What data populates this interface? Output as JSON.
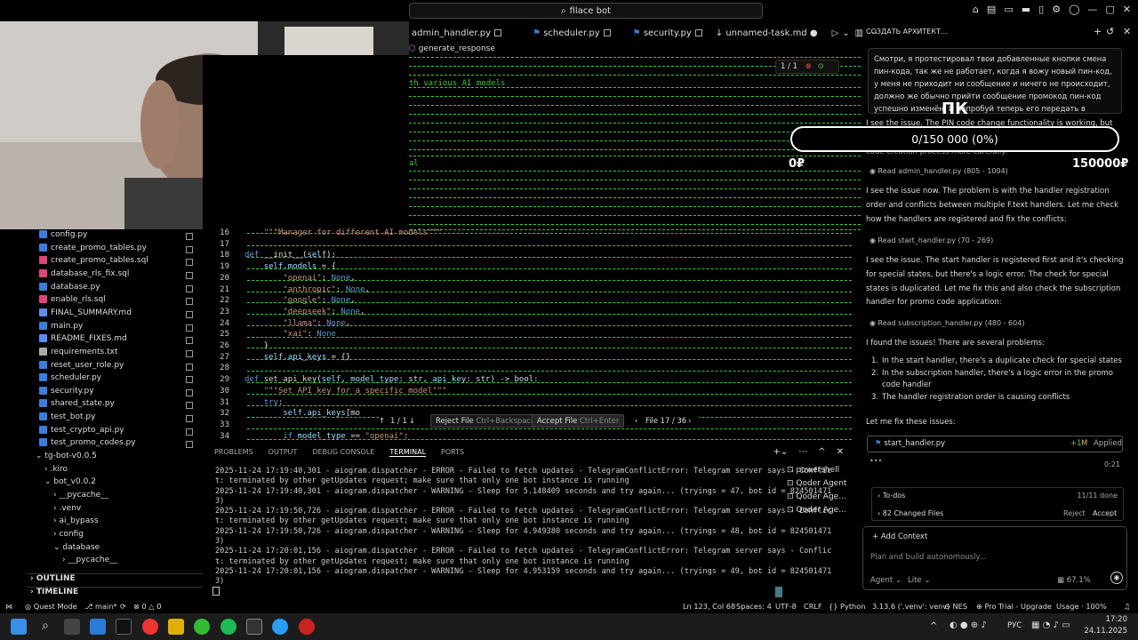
{
  "titlebar": {
    "search": "filace bot"
  },
  "tabs": [
    {
      "label": "admin_handler.py"
    },
    {
      "label": "scheduler.py"
    },
    {
      "label": "security.py"
    },
    {
      "label": "unnamed-task.md"
    }
  ],
  "breadcrumb": "generate_response",
  "editor": {
    "diff_counter": "1 / 1",
    "green_text": "th various AI models",
    "green_text2": "al",
    "lines": [
      {
        "n": "16",
        "html": "    <span class='st'>\"\"\"Manager for different AI models\"\"\"</span>"
      },
      {
        "n": "17",
        "html": ""
      },
      {
        "n": "18",
        "html": "<span class='kw'>def</span> <span class='fn'>__init__</span>(<span class='vr'>self</span>):"
      },
      {
        "n": "19",
        "html": "    <span class='vr'>self</span>.<span class='vr'>models</span> = {"
      },
      {
        "n": "20",
        "html": "        <span class='st'>\"openai\"</span>: <span class='nn'>None</span>,"
      },
      {
        "n": "21",
        "html": "        <span class='st'>\"anthropic\"</span>: <span class='nn'>None</span>,"
      },
      {
        "n": "22",
        "html": "        <span class='st'>\"google\"</span>: <span class='nn'>None</span>,"
      },
      {
        "n": "23",
        "html": "        <span class='st'>\"deepseek\"</span>: <span class='nn'>None</span>,"
      },
      {
        "n": "24",
        "html": "        <span class='st'>\"llama\"</span>: <span class='nn'>None</span>,"
      },
      {
        "n": "25",
        "html": "        <span class='st'>\"xai\"</span>: <span class='nn'>None</span>"
      },
      {
        "n": "26",
        "html": "    }"
      },
      {
        "n": "27",
        "html": "    <span class='vr'>self</span>.<span class='vr'>api_keys</span> = {}"
      },
      {
        "n": "28",
        "html": ""
      },
      {
        "n": "29",
        "html": "<span class='kw'>def</span> <span class='fn'>set_api_key</span>(<span class='vr'>self</span>, <span class='vr'>model_type</span>: str, <span class='vr'>api_key</span>: str) -> bool:"
      },
      {
        "n": "30",
        "html": "    <span class='st'>\"\"\"Set API key for a specific model\"\"\"</span>"
      },
      {
        "n": "31",
        "html": "    <span class='kw'>try</span>:"
      },
      {
        "n": "32",
        "html": "        <span class='vr'>self</span>.<span class='vr'>api_keys</span>[mo"
      },
      {
        "n": "33",
        "html": ""
      },
      {
        "n": "34",
        "html": "        <span class='kw'>if</span> <span class='vr'>model_type</span> == <span class='st'>\"openai\"</span>:"
      }
    ]
  },
  "review_bar": {
    "counter": "1 / 1",
    "reject": "Reject File",
    "reject_shortcut": "Ctrl+Backspace",
    "accept": "Accept File",
    "accept_shortcut": "Ctrl+Enter",
    "file_counter": "File 17 / 36"
  },
  "explorer": {
    "files": [
      {
        "name": "config.py",
        "color": "#3b7ddd"
      },
      {
        "name": "create_promo_tables.py",
        "color": "#3b7ddd"
      },
      {
        "name": "create_promo_tables.sql",
        "color": "#e0457b"
      },
      {
        "name": "database_rls_fix.sql",
        "color": "#e0457b"
      },
      {
        "name": "database.py",
        "color": "#3b7ddd"
      },
      {
        "name": "enable_rls.sql",
        "color": "#e0457b"
      },
      {
        "name": "FINAL_SUMMARY.md",
        "color": "#5b8def"
      },
      {
        "name": "main.py",
        "color": "#3b7ddd"
      },
      {
        "name": "README_FIXES.md",
        "color": "#5b8def"
      },
      {
        "name": "requirements.txt",
        "color": "#aaaaaa"
      },
      {
        "name": "reset_user_role.py",
        "color": "#3b7ddd"
      },
      {
        "name": "scheduler.py",
        "color": "#3b7ddd"
      },
      {
        "name": "security.py",
        "color": "#3b7ddd"
      },
      {
        "name": "shared_state.py",
        "color": "#3b7ddd"
      },
      {
        "name": "test_bot.py",
        "color": "#3b7ddd"
      },
      {
        "name": "test_crypto_api.py",
        "color": "#3b7ddd"
      },
      {
        "name": "test_promo_codes.py",
        "color": "#3b7ddd"
      }
    ],
    "folders": [
      {
        "name": "tg-bot-v0.0.5",
        "indent": 0
      },
      {
        "name": ".kiro",
        "indent": 1
      },
      {
        "name": "bot_v0.0.2",
        "indent": 1
      },
      {
        "name": "__pycache__",
        "indent": 2
      },
      {
        "name": ".venv",
        "indent": 2
      },
      {
        "name": "ai_bypass",
        "indent": 2
      },
      {
        "name": "config",
        "indent": 2
      },
      {
        "name": "database",
        "indent": 2
      },
      {
        "name": "__pycache__",
        "indent": 3
      }
    ],
    "outline": "OUTLINE",
    "timeline": "TIMELINE"
  },
  "panel": {
    "tabs": [
      "PROBLEMS",
      "OUTPUT",
      "DEBUG CONSOLE",
      "TERMINAL",
      "PORTS"
    ],
    "active_tab": "TERMINAL",
    "terminal_lines": [
      "2025-11-24 17:19:40,301 - aiogram.dispatcher - ERROR - Failed to fetch updates - TelegramConflictError: Telegram server says - Conflic",
      "t: terminated by other getUpdates request; make sure that only one bot instance is running",
      "2025-11-24 17:19:40,301 - aiogram.dispatcher - WARNING - Sleep for 5.148409 seconds and try again... (tryings = 47, bot id = 824501471",
      "3)",
      "2025-11-24 17:19:50,726 - aiogram.dispatcher - ERROR - Failed to fetch updates - TelegramConflictError: Telegram server says - Conflic",
      "t: terminated by other getUpdates request; make sure that only one bot instance is running",
      "2025-11-24 17:19:50,726 - aiogram.dispatcher - WARNING - Sleep for 4.949380 seconds and try again... (tryings = 48, bot id = 824501471",
      "3)",
      "2025-11-24 17:20:01,156 - aiogram.dispatcher - ERROR - Failed to fetch updates - TelegramConflictError: Telegram server says - Conflic",
      "t: terminated by other getUpdates request; make sure that only one bot instance is running",
      "2025-11-24 17:20:01,156 - aiogram.dispatcher - WARNING - Sleep for 4.953159 seconds and try again... (tryings = 49, bot id = 824501471",
      "3)"
    ],
    "terminals": [
      "powershell",
      "Qoder Agent",
      "Qoder Age...",
      "Qoder Age..."
    ]
  },
  "chat": {
    "header": "СОЗДАТЬ АРХИТЕКТ...",
    "user_message": "Смотри, я протестировал твои добавленные кнопки смена пин-кода, так же не работает, когда я вожу новый пин-код, у меня не приходит ни сообщение и ничего не происходит, должно же обычно прийти сообщение промокод пин-код успешно изменён. И попробуй теперь его передать в панель. А так же промокод, смотри",
    "p0": "I see the issue. The PIN code change functionality is working, but there",
    "p0b": "code creation process more carefully:",
    "read1": "Read admin_handler.py (805 - 1004)",
    "p1": "I see the issue now. The problem is with the handler registration order and conflicts between multiple F.text handlers. Let me check how the handlers are registered and fix the conflicts:",
    "read2": "Read start_handler.py (70 - 269)",
    "p2": "I see the issue. The start handler is registered first and it's checking for special states, but there's a logic error. The check for special states is duplicated. Let me fix this and also check the subscription handler for promo code application:",
    "read3": "Read subscription_handler.py (480 - 604)",
    "p3": "I found the issues! There are several problems:",
    "list": [
      "In the start handler, there's a duplicate check for special states",
      "In the subscription handler, there's a logic error in the promo code handler",
      "The handler registration order is causing conflicts"
    ],
    "p4": "Let me fix these issues:",
    "applied_file": "start_handler.py",
    "applied_diff": "+1",
    "applied_m": "M",
    "applied_status": "Applied",
    "dots": "•••",
    "elapsed": "0:21",
    "todos": "To-dos",
    "todos_status": "11/11 done",
    "changed": "82 Changed Files",
    "reject": "Reject",
    "accept": "Accept",
    "add_context": "Add Context",
    "placeholder": "Plan and build autonomously...",
    "mode": "Agent",
    "model": "Lite",
    "usage": "67.1%"
  },
  "overlay": {
    "pill": "0/150 000 (0%)",
    "pk": "ПК",
    "zero": "0₽",
    "big": "150000₽"
  },
  "statusbar": {
    "quest": "Quest Mode",
    "branch": "main*",
    "errors": "0",
    "warnings": "0",
    "pos": "Ln 123, Col 68",
    "spaces": "Spaces: 4",
    "enc": "UTF-8",
    "eol": "CRLF",
    "lang": "Python",
    "interp": "3.13.6 ('.venv': venv)",
    "nes": "NES",
    "plan": "Pro Trial - Upgrade",
    "usage": "Usage · 100%"
  },
  "taskbar": {
    "lang": "РУС",
    "time": "17:20",
    "date": "24.11.2025"
  }
}
